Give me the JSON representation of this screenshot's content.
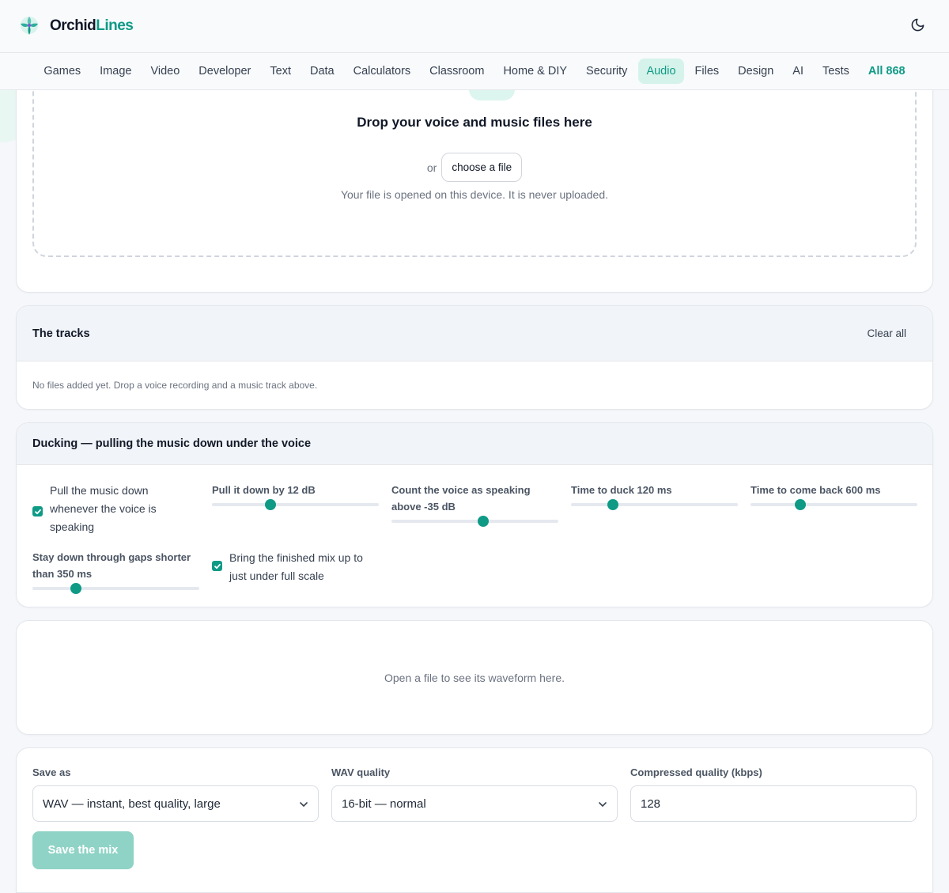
{
  "header": {
    "brand_part1": "Orchid",
    "brand_part2": "Lines",
    "logo_icon": "orchid-logo-icon",
    "theme_icon": "moon-icon"
  },
  "nav": {
    "items": [
      "Games",
      "Image",
      "Video",
      "Developer",
      "Text",
      "Data",
      "Calculators",
      "Classroom",
      "Home & DIY",
      "Security",
      "Audio",
      "Files",
      "Design",
      "AI",
      "Tests"
    ],
    "active": "Audio",
    "all_label": "All 868"
  },
  "drop": {
    "icon": "upload-tray-icon",
    "title": "Drop your voice and music files here",
    "or": "or",
    "choose": "choose a file",
    "note": "Your file is opened on this device. It is never uploaded."
  },
  "tracks": {
    "title": "The tracks",
    "clear": "Clear all",
    "empty": "No files added yet. Drop a voice recording and a music track above."
  },
  "ducking": {
    "title": "Ducking — pulling the music down under the voice",
    "check_pull": "Pull the music down whenever the voice is speaking",
    "check_pull_checked": true,
    "pull_label": "Pull it down by 12 dB",
    "pull_value_fraction": 0.35,
    "threshold_label": "Count the voice as speaking above -35 dB",
    "threshold_value_fraction": 0.55,
    "attack_label": "Time to duck 120 ms",
    "attack_value_fraction": 0.25,
    "release_label": "Time to come back 600 ms",
    "release_value_fraction": 0.3,
    "hold_label": "Stay down through gaps shorter than 350 ms",
    "hold_value_fraction": 0.26,
    "check_normalize": "Bring the finished mix up to just under full scale",
    "check_normalize_checked": true
  },
  "waveform": {
    "empty": "Open a file to see its waveform here."
  },
  "save": {
    "format_label": "Save as",
    "format_value": "WAV — instant, best quality, large",
    "wav_label": "WAV quality",
    "wav_value": "16-bit — normal",
    "kbps_label": "Compressed quality (kbps)",
    "kbps_value": "128",
    "button": "Save the mix",
    "accent": "#0f9a86"
  }
}
